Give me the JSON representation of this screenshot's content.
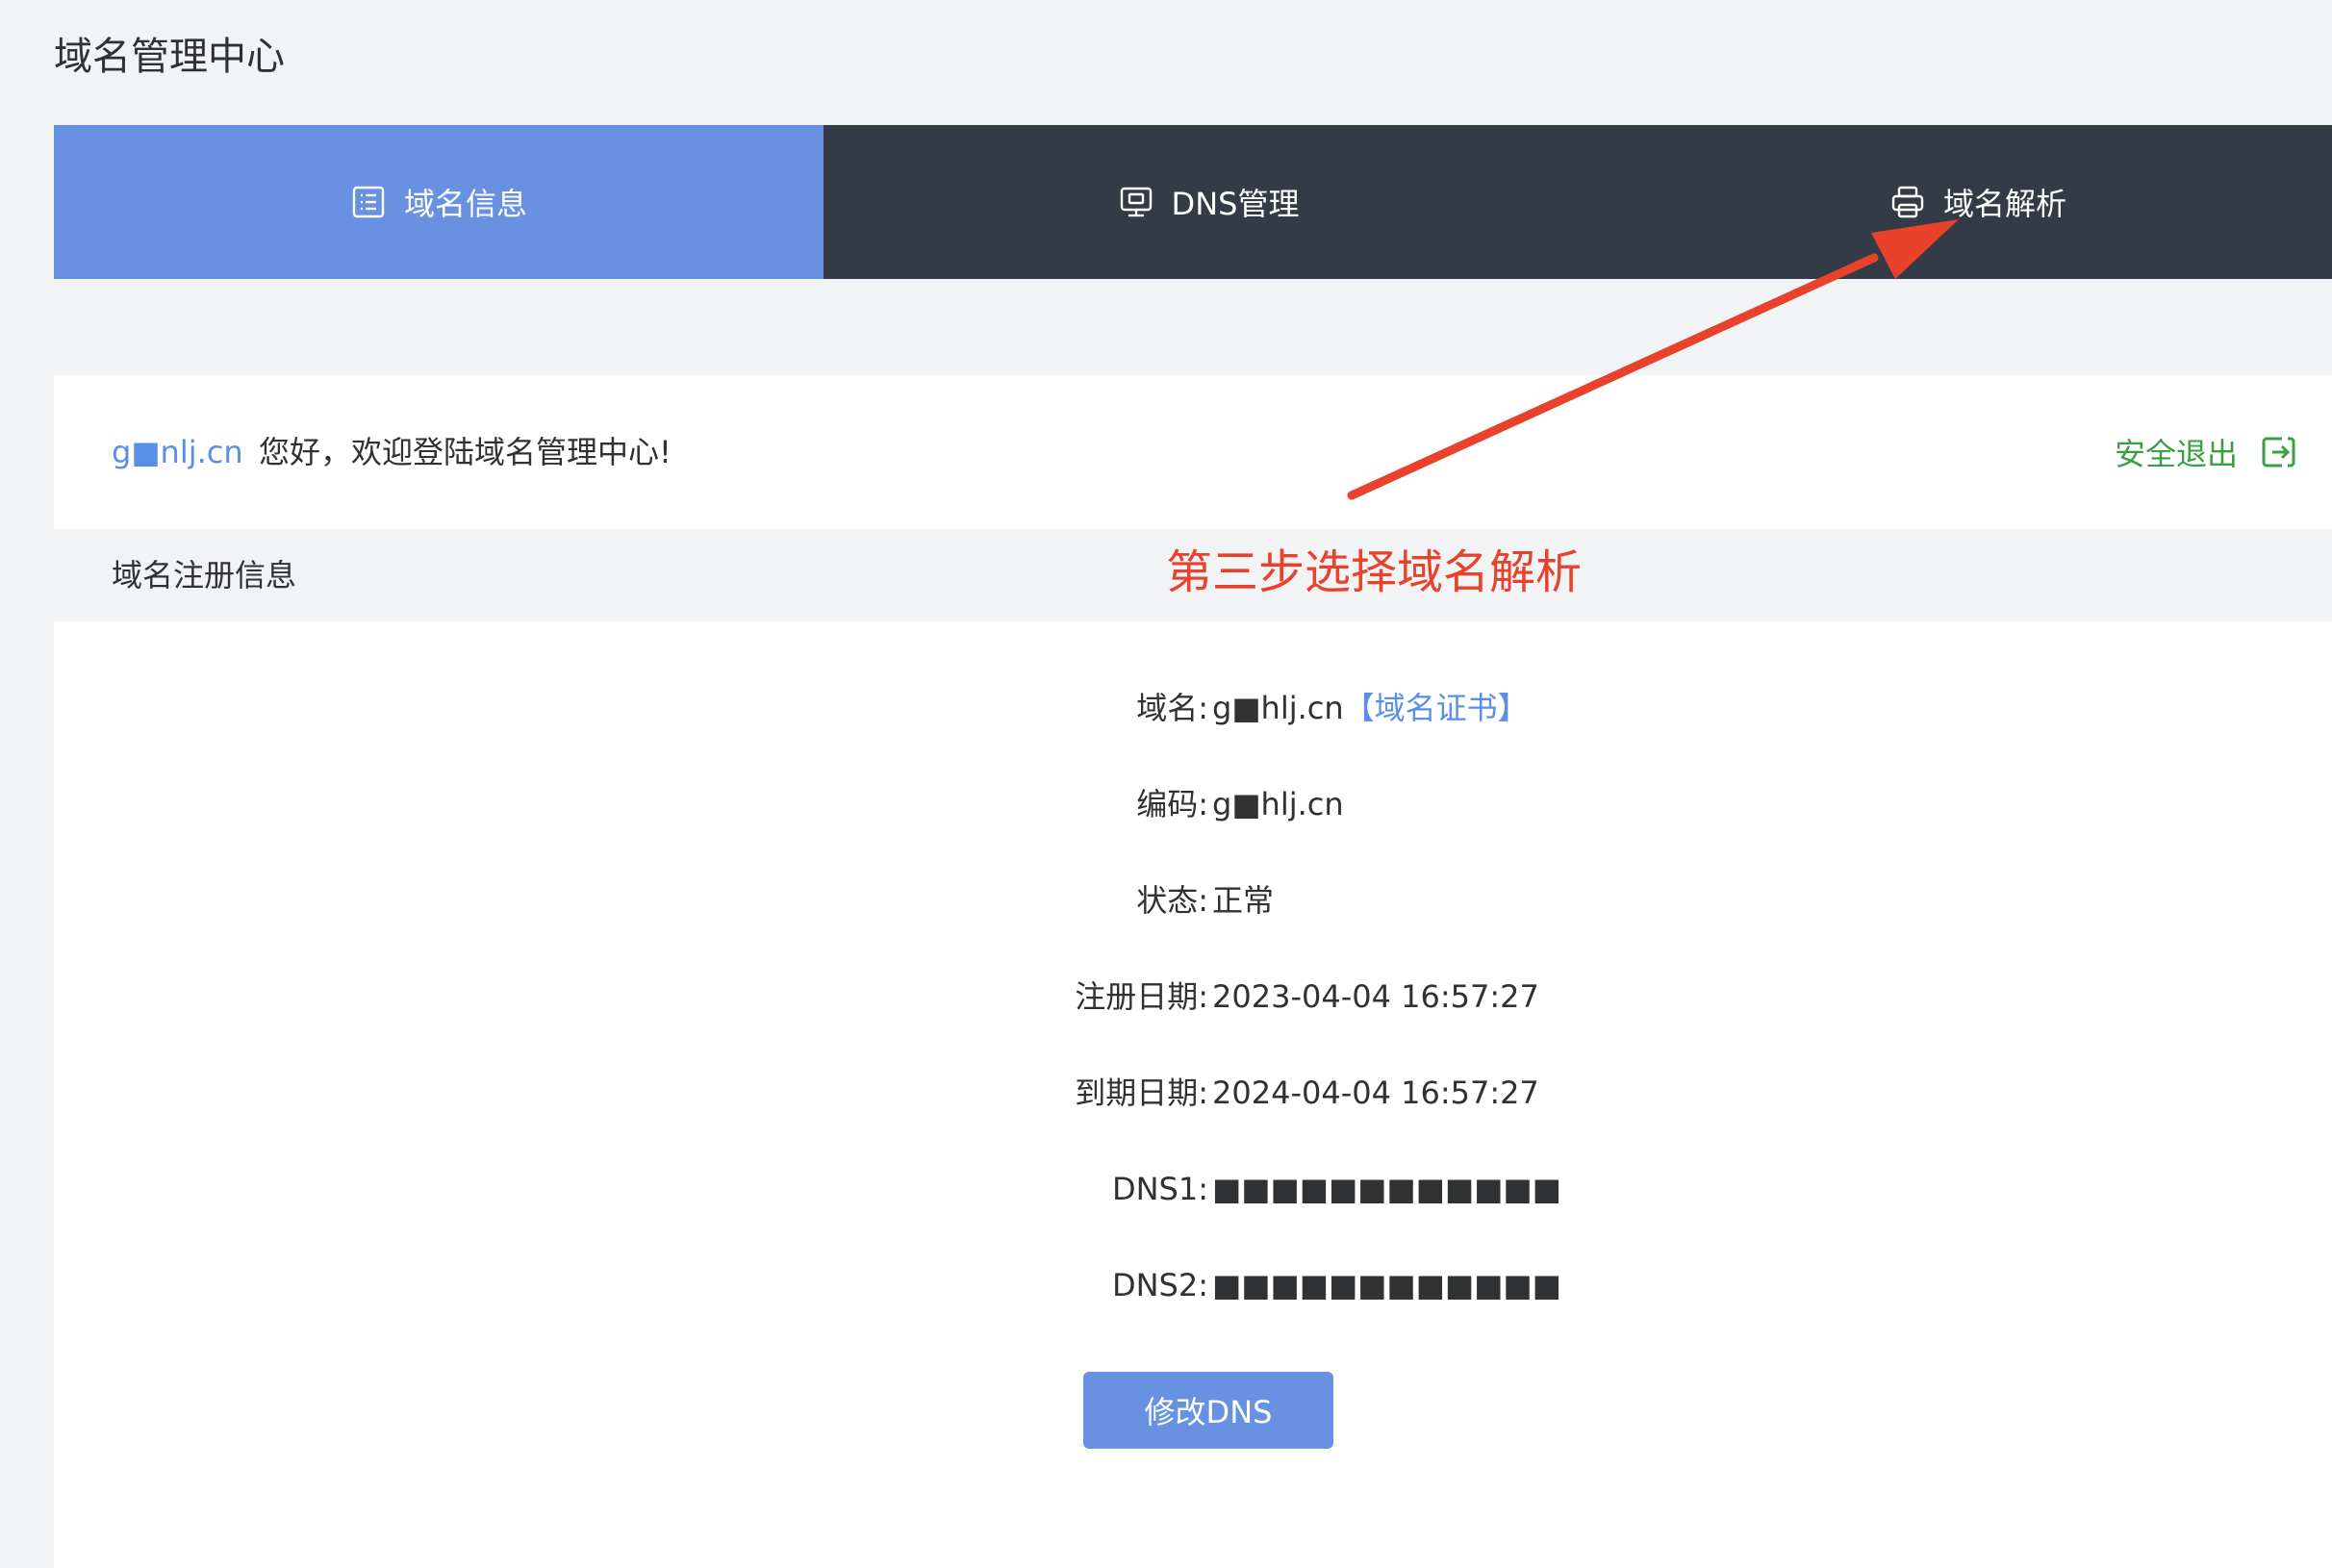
{
  "header": {
    "title": "域名管理中心"
  },
  "tabs": [
    {
      "label": "域名信息",
      "icon": "list-icon",
      "active": true
    },
    {
      "label": "DNS管理",
      "icon": "monitor-icon",
      "active": false
    },
    {
      "label": "域名解析",
      "icon": "printer-icon",
      "active": false
    }
  ],
  "welcome": {
    "user": "g■nlj.cn",
    "greeting": "您好，欢迎登陆域名管理中心!",
    "logout_label": "安全退出",
    "logout_icon": "logout-icon"
  },
  "section": {
    "title": "域名注册信息"
  },
  "details": [
    {
      "key": "域名:",
      "value": "g■hlj.cn",
      "link": "【域名证书】"
    },
    {
      "key": "编码:",
      "value": "g■hlj.cn"
    },
    {
      "key": "状态:",
      "value": "正常"
    },
    {
      "key": "注册日期:",
      "value": "2023-04-04 16:57:27"
    },
    {
      "key": "到期日期:",
      "value": "2024-04-04 16:57:27"
    },
    {
      "key": "DNS1:",
      "value": "■■■■■■■■■■■■"
    },
    {
      "key": "DNS2:",
      "value": "■■■■■■■■■■■■"
    }
  ],
  "button": {
    "label": "修改DNS"
  },
  "annotation": {
    "text": "第三步选择域名解析",
    "color": "#e8412c"
  },
  "colors": {
    "active_tab": "#6891e1",
    "dark_tab": "#343a46",
    "link": "#5b8ee6",
    "logout": "#3aa043"
  }
}
